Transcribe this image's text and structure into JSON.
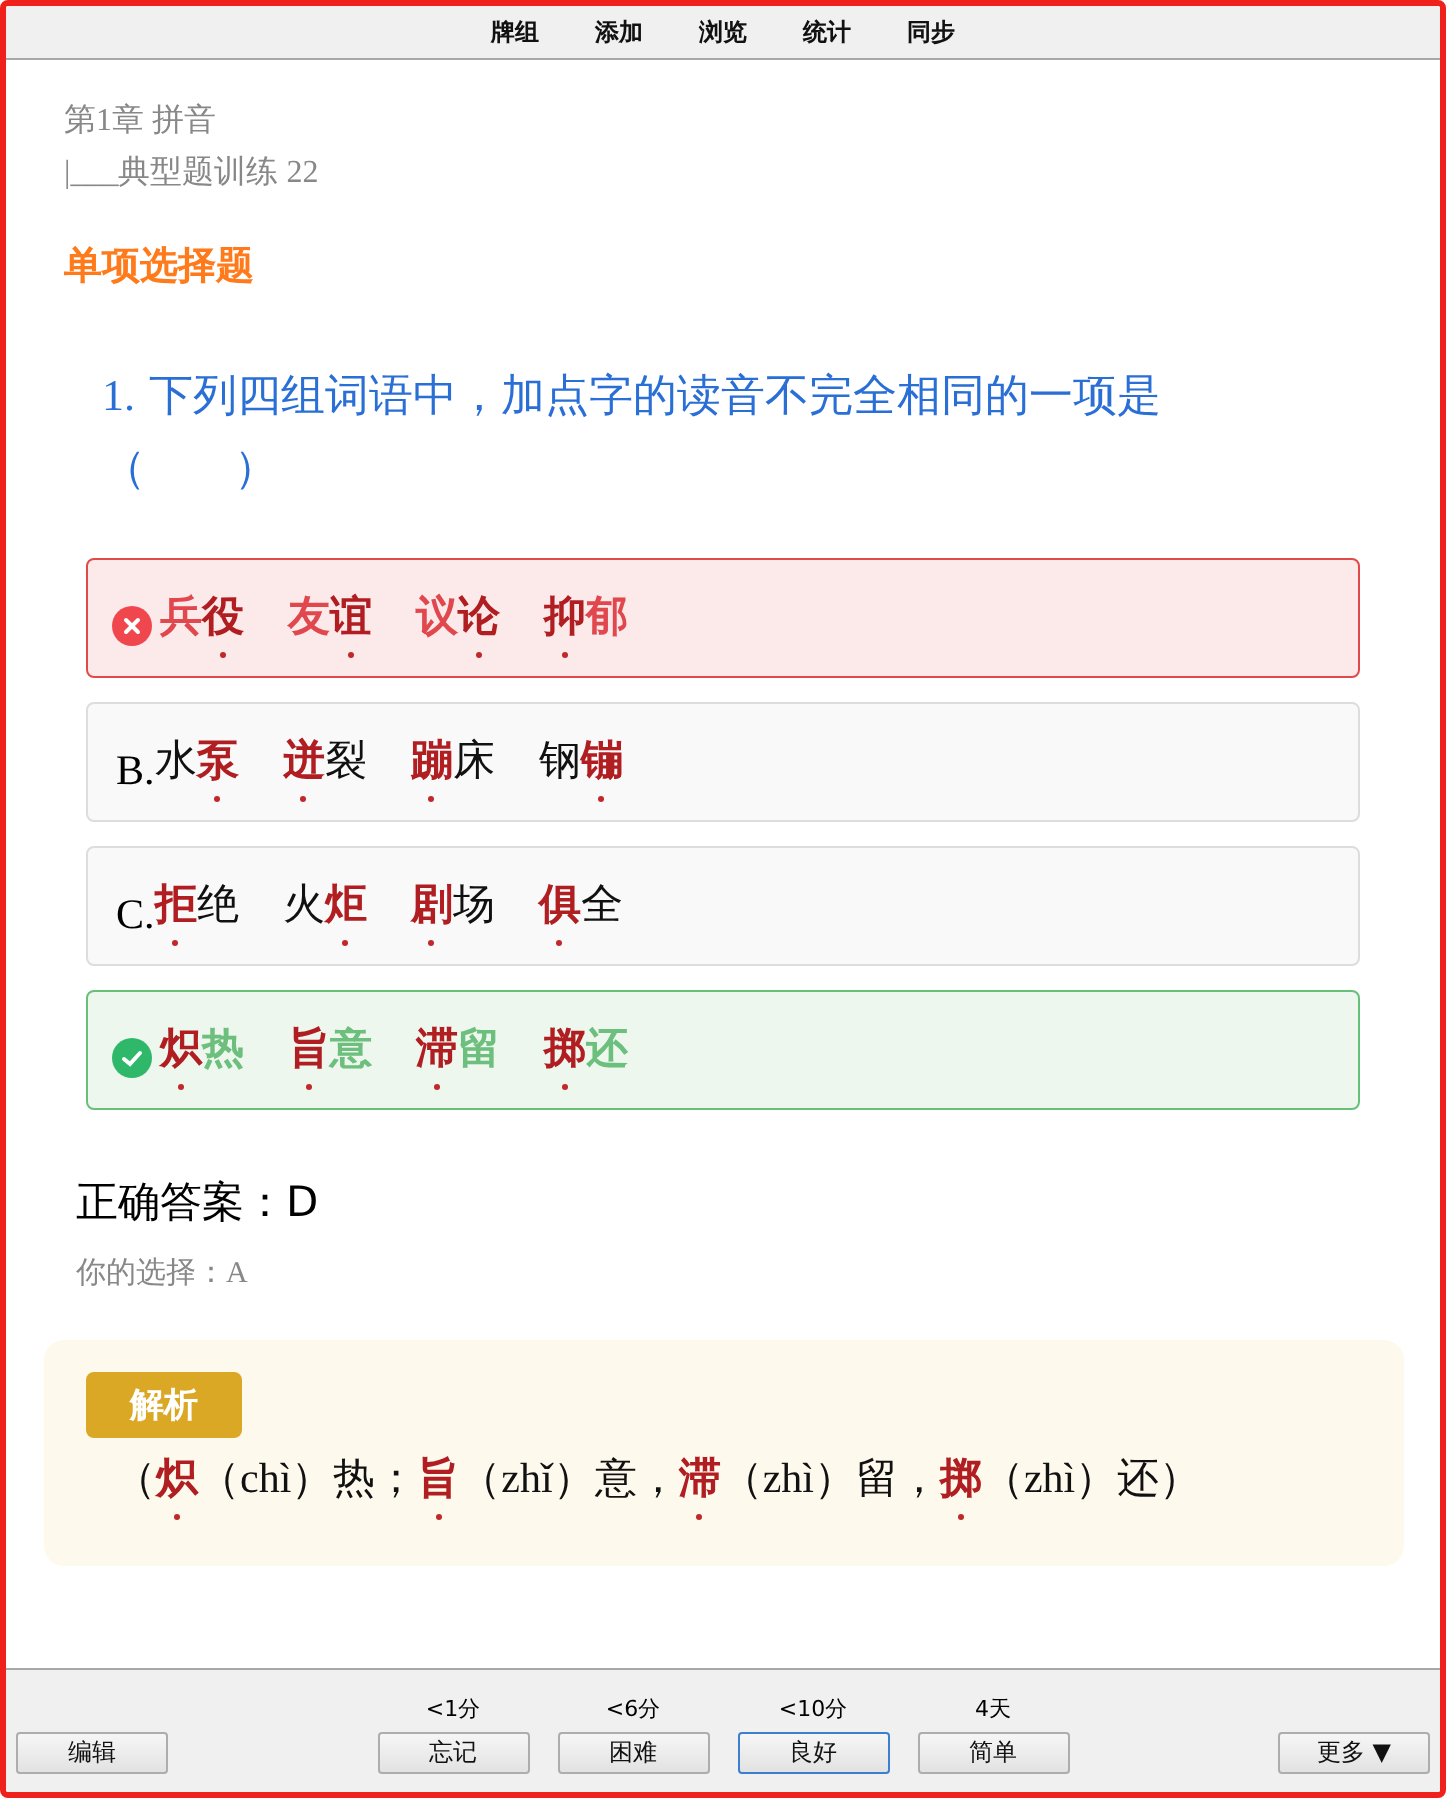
{
  "nav": [
    "牌组",
    "添加",
    "浏览",
    "统计",
    "同步"
  ],
  "breadcrumb": {
    "chapter": "第1章 拼音",
    "section": "|___典型题训练 22"
  },
  "section_title": "单项选择题",
  "question": {
    "number": "1.",
    "text": "下列四组词语中，加点字的读音不完全相同的一项是（　　）"
  },
  "options": [
    {
      "wrong": true,
      "correct": false,
      "words": [
        [
          {
            "t": "兵",
            "em": false
          },
          {
            "t": "役",
            "em": true
          }
        ],
        [
          {
            "t": "友",
            "em": false
          },
          {
            "t": "谊",
            "em": true
          }
        ],
        [
          {
            "t": "议",
            "em": false
          },
          {
            "t": "论",
            "em": true
          }
        ],
        [
          {
            "t": "抑",
            "em": true
          },
          {
            "t": "郁",
            "em": false
          }
        ]
      ]
    },
    {
      "wrong": false,
      "correct": false,
      "prefix": "B.",
      "words": [
        [
          {
            "t": "水",
            "em": false
          },
          {
            "t": "泵",
            "em": true
          }
        ],
        [
          {
            "t": "迸",
            "em": true
          },
          {
            "t": "裂",
            "em": false
          }
        ],
        [
          {
            "t": "蹦",
            "em": true
          },
          {
            "t": "床",
            "em": false
          }
        ],
        [
          {
            "t": "钢",
            "em": false
          },
          {
            "t": "镚",
            "em": true
          }
        ]
      ]
    },
    {
      "wrong": false,
      "correct": false,
      "prefix": "C.",
      "words": [
        [
          {
            "t": "拒",
            "em": true
          },
          {
            "t": "绝",
            "em": false
          }
        ],
        [
          {
            "t": "火",
            "em": false
          },
          {
            "t": "炬",
            "em": true
          }
        ],
        [
          {
            "t": "剧",
            "em": true
          },
          {
            "t": "场",
            "em": false
          }
        ],
        [
          {
            "t": "俱",
            "em": true
          },
          {
            "t": "全",
            "em": false
          }
        ]
      ]
    },
    {
      "wrong": false,
      "correct": true,
      "words": [
        [
          {
            "t": "炽",
            "em": true
          },
          {
            "t": "热",
            "em": false
          }
        ],
        [
          {
            "t": "旨",
            "em": true
          },
          {
            "t": "意",
            "em": false
          }
        ],
        [
          {
            "t": "滞",
            "em": true
          },
          {
            "t": "留",
            "em": false
          }
        ],
        [
          {
            "t": "掷",
            "em": true
          },
          {
            "t": "还",
            "em": false
          }
        ]
      ]
    }
  ],
  "correct_answer": "正确答案：D",
  "your_choice": "你的选择：A",
  "explanation": {
    "badge": "解析",
    "segments": [
      {
        "t": "（",
        "em": false
      },
      {
        "t": "炽",
        "em": true
      },
      {
        "t": "（chì）热；",
        "em": false
      },
      {
        "t": "旨",
        "em": true
      },
      {
        "t": "（zhǐ）意，",
        "em": false
      },
      {
        "t": "滞",
        "em": true
      },
      {
        "t": "（zhì）留，",
        "em": false
      },
      {
        "t": "掷",
        "em": true
      },
      {
        "t": "（zhì）还）",
        "em": false
      }
    ]
  },
  "bottom": {
    "edit": "编辑",
    "more": "更多 ▼",
    "answers": [
      {
        "interval": "<1分",
        "label": "忘记",
        "selected": false
      },
      {
        "interval": "<6分",
        "label": "困难",
        "selected": false
      },
      {
        "interval": "<10分",
        "label": "良好",
        "selected": true
      },
      {
        "interval": "4天",
        "label": "简单",
        "selected": false
      }
    ]
  }
}
